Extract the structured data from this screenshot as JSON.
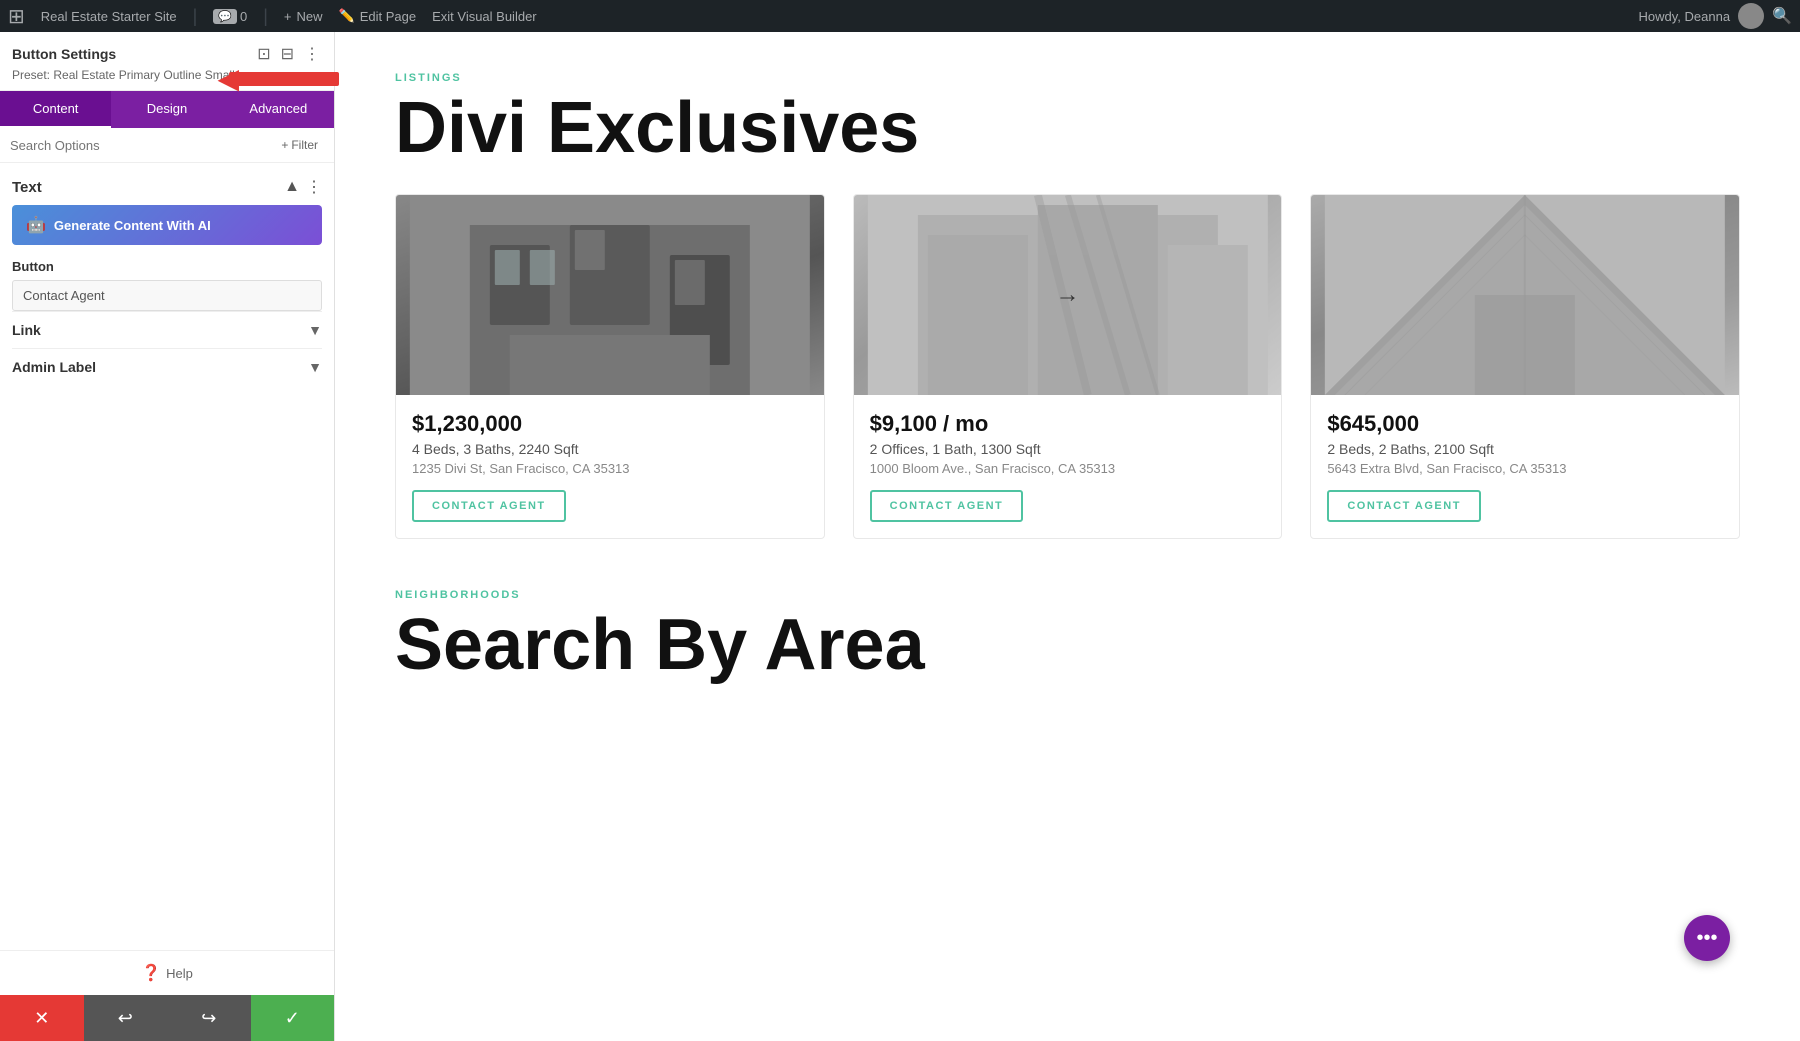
{
  "adminBar": {
    "wpIcon": "W",
    "siteName": "Real Estate Starter Site",
    "commentCount": "0",
    "newLabel": "New",
    "editPageLabel": "Edit Page",
    "exitBuilderLabel": "Exit Visual Builder",
    "howdyText": "Howdy, Deanna"
  },
  "buttonSettings": {
    "title": "Button Settings",
    "preset": "Preset: Real Estate Primary Outline Small",
    "tabs": [
      {
        "label": "Content",
        "active": true
      },
      {
        "label": "Design",
        "active": false
      },
      {
        "label": "Advanced",
        "active": false
      }
    ],
    "searchPlaceholder": "Search Options",
    "filterLabel": "Filter",
    "textSection": {
      "title": "Text",
      "aiButtonLabel": "Generate Content With AI"
    },
    "buttonSection": {
      "label": "Button",
      "inputValue": "Contact Agent"
    },
    "linkSection": {
      "title": "Link"
    },
    "adminLabelSection": {
      "title": "Admin Label"
    },
    "helpLabel": "Help"
  },
  "bottomBar": {
    "cancelIcon": "✕",
    "undoIcon": "↩",
    "redoIcon": "↪",
    "saveIcon": "✓"
  },
  "mainContent": {
    "listingsLabel": "LISTINGS",
    "mainTitle": "Divi Exclusives",
    "listings": [
      {
        "price": "$1,230,000",
        "details": "4 Beds, 3 Baths, 2240 Sqft",
        "address": "1235 Divi St, San Fracisco, CA 35313",
        "contactLabel": "CONTACT AGENT",
        "imageType": "building-1"
      },
      {
        "price": "$9,100 / mo",
        "details": "2 Offices, 1 Bath, 1300 Sqft",
        "address": "1000 Bloom Ave., San Fracisco, CA 35313",
        "contactLabel": "CONTACT AGENT",
        "imageType": "building-2",
        "hasArrow": true
      },
      {
        "price": "$645,000",
        "details": "2 Beds, 2 Baths, 2100 Sqft",
        "address": "5643 Extra Blvd, San Fracisco, CA 35313",
        "contactLabel": "CONTACT AGENT",
        "imageType": "building-3"
      }
    ],
    "neighborhoodsLabel": "NEIGHBORHOODS",
    "neighborhoodsTitle": "Search By Area",
    "floatingBtnIcon": "•••"
  }
}
